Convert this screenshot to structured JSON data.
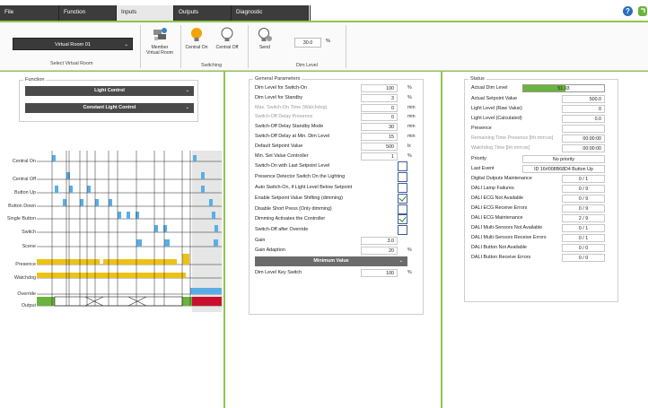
{
  "tabs": [
    {
      "label": "File",
      "active": false
    },
    {
      "label": "Function",
      "active": false
    },
    {
      "label": "Inputs",
      "active": true
    },
    {
      "label": "Outputs",
      "active": false
    },
    {
      "label": "Diagnostic",
      "active": false
    }
  ],
  "ribbon": {
    "virtual_room_select": "Virtual Room 01",
    "select_virtual_room_label": "Select Virtual Room",
    "member_label_1": "Member",
    "member_label_2": "Virtual Room",
    "central_on_label": "Central On",
    "central_off_label": "Central Off",
    "switching_label": "Switching",
    "send_label": "Send",
    "dim_value": "30.0",
    "dim_unit": "%",
    "dim_level_label": "Dim Level"
  },
  "function_panel": {
    "legend": "Function",
    "select_1": "Light Control",
    "select_2": "Constant Light Control"
  },
  "diagram": {
    "signals": [
      "Central On",
      "Central Off",
      "Button Up",
      "Button Down",
      "Single Button",
      "Switch",
      "Scene",
      "Presence",
      "Watchdog",
      "Override",
      "Output"
    ],
    "colors": {
      "pulse": "#5aaee6",
      "presence": "#ecc216",
      "green": "#6ab33e",
      "red": "#c8102e",
      "highlight": "#e6e6e6"
    }
  },
  "general_params": {
    "legend": "General Parameters",
    "rows": [
      {
        "label": "Dim Level for Switch-On",
        "value": "100",
        "unit": "%",
        "dim": false
      },
      {
        "label": "Dim Level for Standby",
        "value": "3",
        "unit": "%",
        "dim": false
      },
      {
        "label": "Max. Switch-On Time (Watchdog)",
        "value": "0",
        "unit": "min",
        "dim": true
      },
      {
        "label": "Switch-Off Delay Presence",
        "value": "0",
        "unit": "min",
        "dim": true
      },
      {
        "label": "Switch-Off Delay Standby Mode",
        "value": "30",
        "unit": "min",
        "dim": false
      },
      {
        "label": "Switch-Off Delay at Min. Dim Level",
        "value": "15",
        "unit": "min",
        "dim": false
      },
      {
        "label": "Default Setpoint Value",
        "value": "500",
        "unit": "lx",
        "dim": false
      },
      {
        "label": "Min. Set Value Controller",
        "value": "1",
        "unit": "%",
        "dim": false
      }
    ],
    "checks": [
      {
        "label": "Switch-On with Last Setpoint Level",
        "checked": false
      },
      {
        "label": "Presence Detector Switch On the Lighting",
        "checked": false
      },
      {
        "label": "Auto Switch-On, if Light Level Below Setpoint",
        "checked": false
      },
      {
        "label": "Enable Setpoint Value Shifting (dimming)",
        "checked": true
      },
      {
        "label": "Disable Short Press (Only dimming)",
        "checked": false
      },
      {
        "label": "Dimming Activates the Controller",
        "checked": true
      },
      {
        "label": "Switch-Off after Override",
        "checked": false
      }
    ],
    "gain_label": "Gain",
    "gain_value": "3.0",
    "gain_adaption_label": "Gain Adaption",
    "gain_adaption_value": "20",
    "gain_adaption_unit": "%",
    "minimum_value_select": "Minimum Value",
    "dim_level_key_label": "Dim Level Key Switch",
    "dim_level_key_value": "100",
    "dim_level_key_unit": "%"
  },
  "status": {
    "legend": "Status",
    "actual_dim_label": "Actual Dim Level",
    "actual_dim_value": "51.93",
    "actual_dim_fraction": 0.5193,
    "rows": [
      {
        "label": "Actual Setpoint Value",
        "value": "500.0",
        "dim": false
      },
      {
        "label": "Light Level (Raw Value)",
        "value": "0",
        "dim": false
      },
      {
        "label": "Light Level (Calculated)",
        "value": "0.0",
        "dim": false
      },
      {
        "label": "Presence",
        "value": "",
        "dim": false
      },
      {
        "label": "Remaining Time Presence [hh:mm:ss]",
        "value": "00:00:00",
        "dim": true
      },
      {
        "label": "Watchdog Time [hh:mm:ss]",
        "value": "00:00:00",
        "dim": true
      }
    ],
    "priority_label": "Priority",
    "priority_value": "No priority",
    "last_event_label": "Last Event",
    "last_event_value": "ID 16#008B68D4 Button Up",
    "diag_rows": [
      {
        "label": "Digital Outputs Maintenance",
        "value": "0 / 1"
      },
      {
        "label": "DALI Lamp Failures",
        "value": "0 / 9"
      },
      {
        "label": "DALI ECG Not Available",
        "value": "0 / 9"
      },
      {
        "label": "DALI ECG Receive Errors",
        "value": "0 / 9"
      },
      {
        "label": "DALI ECG Maintenance",
        "value": "2 / 9"
      },
      {
        "label": "DALI Multi-Sensors Not Available",
        "value": "0 / 1"
      },
      {
        "label": "DALI Multi-Sensors Receive Errors",
        "value": "0 / 1"
      },
      {
        "label": "DALI Button Not Available",
        "value": "0 / 0"
      },
      {
        "label": "DALI Button Receive Errors",
        "value": "0 / 0"
      }
    ]
  }
}
